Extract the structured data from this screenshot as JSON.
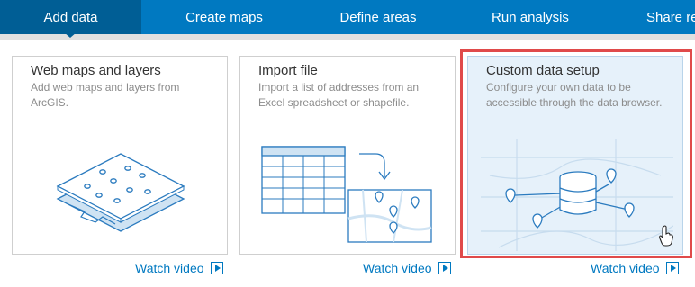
{
  "nav": {
    "tabs": [
      {
        "label": "Add data",
        "active": true
      },
      {
        "label": "Create maps"
      },
      {
        "label": "Define areas"
      },
      {
        "label": "Run analysis"
      },
      {
        "label": "Share re"
      }
    ]
  },
  "cards": [
    {
      "title": "Web maps and layers",
      "description": "Add web maps and layers from ArcGIS.",
      "icon": "map-layers-icon"
    },
    {
      "title": "Import file",
      "description": "Import a list of addresses from an Excel spreadsheet or shapefile.",
      "icon": "spreadsheet-to-map-icon"
    },
    {
      "title": "Custom data setup",
      "description": "Configure your own data to be accessible through the data browser.",
      "icon": "database-network-icon",
      "selected": true
    }
  ],
  "watch_video_label": "Watch video",
  "colors": {
    "nav_bg": "#0079c1",
    "active_tab": "#005e95",
    "highlight": "#e04a4a",
    "selected_card": "#e6f1fa"
  }
}
